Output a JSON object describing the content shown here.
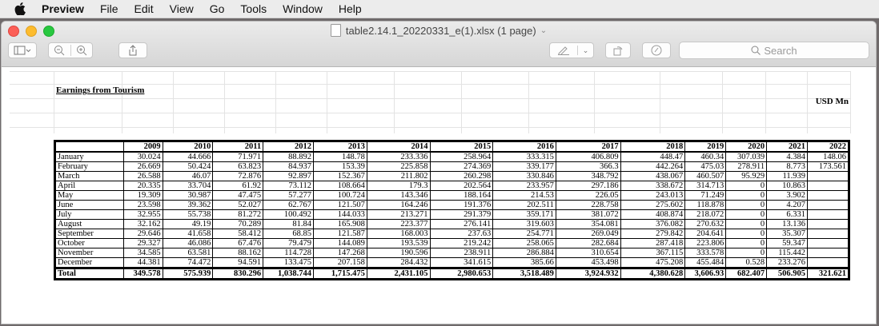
{
  "menubar": {
    "app": "Preview",
    "items": [
      "File",
      "Edit",
      "View",
      "Go",
      "Tools",
      "Window",
      "Help"
    ]
  },
  "window": {
    "title": "table2.14.1_20220331_e(1).xlsx (1 page)",
    "search_placeholder": "Search"
  },
  "sheet": {
    "title": "Earnings from Tourism",
    "unit": "USD Mn",
    "years": [
      "2009",
      "2010",
      "2011",
      "2012",
      "2013",
      "2014",
      "2015",
      "2016",
      "2017",
      "2018",
      "2019",
      "2020",
      "2021",
      "2022"
    ],
    "rows": [
      {
        "month": "January",
        "values": [
          "30.024",
          "44.666",
          "71.971",
          "88.892",
          "148.78",
          "233.336",
          "258.964",
          "333.315",
          "406.809",
          "448.47",
          "460.34",
          "307.039",
          "4.384",
          "148.06"
        ]
      },
      {
        "month": "February",
        "values": [
          "26.669",
          "50.424",
          "63.823",
          "84.937",
          "153.39",
          "225.858",
          "274.369",
          "339.177",
          "366.3",
          "442.264",
          "475.03",
          "278.911",
          "8.773",
          "173.561"
        ]
      },
      {
        "month": "March",
        "values": [
          "26.588",
          "46.07",
          "72.876",
          "92.897",
          "152.367",
          "211.802",
          "260.298",
          "330.846",
          "348.792",
          "438.067",
          "460.507",
          "95.929",
          "11.939",
          ""
        ]
      },
      {
        "month": "April",
        "values": [
          "20.335",
          "33.704",
          "61.92",
          "73.112",
          "108.664",
          "179.3",
          "202.564",
          "233.957",
          "297.186",
          "338.672",
          "314.713",
          "0",
          "10.863",
          ""
        ]
      },
      {
        "month": "May",
        "values": [
          "19.309",
          "30.987",
          "47.475",
          "57.277",
          "100.724",
          "143.346",
          "188.164",
          "214.53",
          "226.05",
          "243.013",
          "71.249",
          "0",
          "3.902",
          ""
        ]
      },
      {
        "month": "June",
        "values": [
          "23.598",
          "39.362",
          "52.027",
          "62.767",
          "121.507",
          "164.246",
          "191.376",
          "202.511",
          "228.758",
          "275.602",
          "118.878",
          "0",
          "4.207",
          ""
        ]
      },
      {
        "month": "July",
        "values": [
          "32.955",
          "55.738",
          "81.272",
          "100.492",
          "144.033",
          "213.271",
          "291.379",
          "359.171",
          "381.072",
          "408.874",
          "218.072",
          "0",
          "6.331",
          ""
        ]
      },
      {
        "month": "August",
        "values": [
          "32.162",
          "49.19",
          "70.289",
          "81.84",
          "165.908",
          "223.377",
          "276.141",
          "319.603",
          "354.081",
          "376.082",
          "270.632",
          "0",
          "13.136",
          ""
        ]
      },
      {
        "month": "September",
        "values": [
          "29.646",
          "41.658",
          "58.412",
          "68.85",
          "121.587",
          "168.003",
          "237.63",
          "254.771",
          "269.049",
          "279.842",
          "204.641",
          "0",
          "35.307",
          ""
        ]
      },
      {
        "month": "October",
        "values": [
          "29.327",
          "46.086",
          "67.476",
          "79.479",
          "144.089",
          "193.539",
          "219.242",
          "258.065",
          "282.684",
          "287.418",
          "223.806",
          "0",
          "59.347",
          ""
        ]
      },
      {
        "month": "November",
        "values": [
          "34.585",
          "63.581",
          "88.162",
          "114.728",
          "147.268",
          "190.596",
          "238.911",
          "286.884",
          "310.654",
          "367.115",
          "333.578",
          "0",
          "115.442",
          ""
        ]
      },
      {
        "month": "December",
        "values": [
          "44.381",
          "74.472",
          "94.591",
          "133.475",
          "207.158",
          "284.432",
          "341.615",
          "385.66",
          "453.498",
          "475.208",
          "455.484",
          "0.528",
          "233.276",
          ""
        ]
      }
    ],
    "total": {
      "label": "Total",
      "values": [
        "349.578",
        "575.939",
        "830.296",
        "1,038.744",
        "1,715.475",
        "2,431.105",
        "2,980.653",
        "3,518.489",
        "3,924.932",
        "4,380.628",
        "3,606.93",
        "682.407",
        "506.905",
        "321.621"
      ]
    }
  }
}
